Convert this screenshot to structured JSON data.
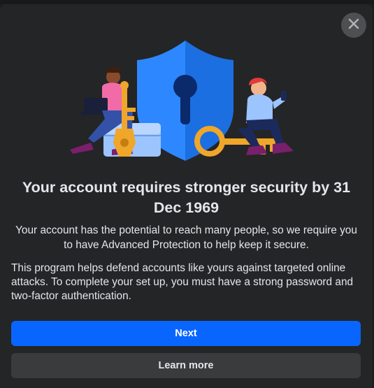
{
  "dialog": {
    "title": "Your account requires stronger security by 31 Dec 1969",
    "intro": "Your account has the potential to reach many people, so we require you to have Advanced Protection to help keep it secure.",
    "body": "This program helps defend accounts like yours against targeted online attacks. To complete your set up, you must have a strong password and two-factor authentication.",
    "next_label": "Next",
    "learn_more_label": "Learn more",
    "close_icon": "close-icon",
    "illustration": "security-illustration"
  },
  "colors": {
    "primary_button": "#0866ff",
    "secondary_button": "#3a3b3c",
    "dialog_background": "#242526",
    "text": "#e4e6eb"
  }
}
